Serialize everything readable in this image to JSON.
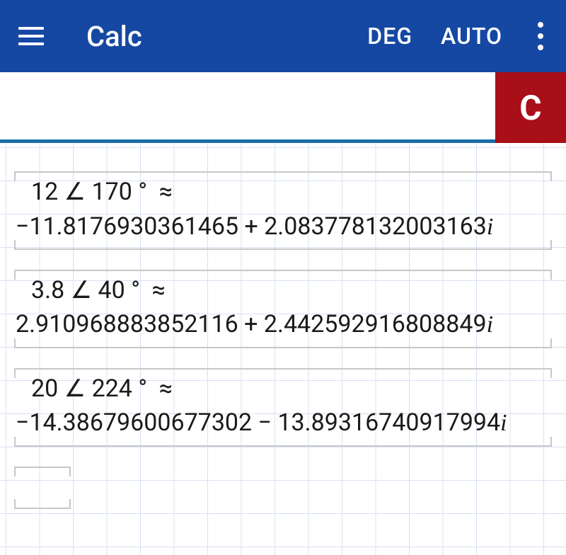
{
  "header": {
    "title": "Calc",
    "deg_label": "DEG",
    "auto_label": "AUTO"
  },
  "clear_label": "C",
  "results": [
    {
      "input_mag": "12",
      "input_angle": "170",
      "output_real": "−11.8176930361465",
      "output_imag": "+ 2.083778132003163"
    },
    {
      "input_mag": "3.8",
      "input_angle": "40",
      "output_real": "2.910968883852116",
      "output_imag": "+ 2.442592916808849"
    },
    {
      "input_mag": "20",
      "input_angle": "224",
      "output_real": "−14.38679600677302",
      "output_imag": "− 13.89316740917994"
    }
  ]
}
